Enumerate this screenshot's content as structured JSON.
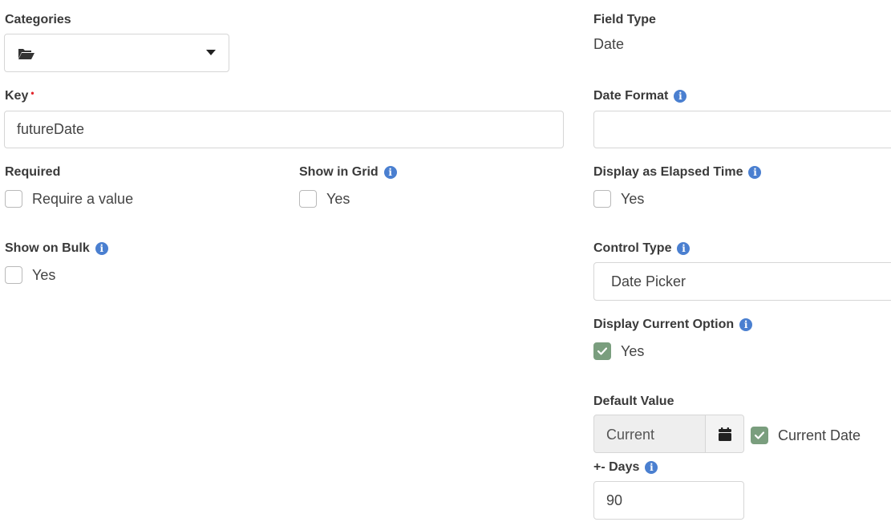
{
  "left": {
    "categories": {
      "label": "Categories",
      "icon": "folder-open-icon"
    },
    "key": {
      "label": "Key",
      "required_marker": "•",
      "value": "futureDate"
    },
    "required": {
      "label": "Required",
      "checkbox_label": "Require a value",
      "checked": false
    },
    "show_in_grid": {
      "label": "Show in Grid",
      "checkbox_label": "Yes",
      "checked": false
    },
    "show_on_bulk": {
      "label": "Show on Bulk",
      "checkbox_label": "Yes",
      "checked": false
    }
  },
  "right": {
    "field_type": {
      "label": "Field Type",
      "value": "Date"
    },
    "date_format": {
      "label": "Date Format",
      "value": ""
    },
    "display_elapsed": {
      "label": "Display as Elapsed Time",
      "checkbox_label": "Yes",
      "checked": false
    },
    "control_type": {
      "label": "Control Type",
      "value": "Date Picker"
    },
    "display_current_option": {
      "label": "Display Current Option",
      "checkbox_label": "Yes",
      "checked": true
    },
    "default_value": {
      "label": "Default Value",
      "value": "Current",
      "current_date_label": "Current Date",
      "current_date_checked": true
    },
    "days": {
      "label": "+- Days",
      "value": "90"
    }
  },
  "info_glyph": "i",
  "colors": {
    "info": "#4a7fd0",
    "checked": "#7a9e7e",
    "required": "#e2252b",
    "border": "#d6d6d6"
  }
}
